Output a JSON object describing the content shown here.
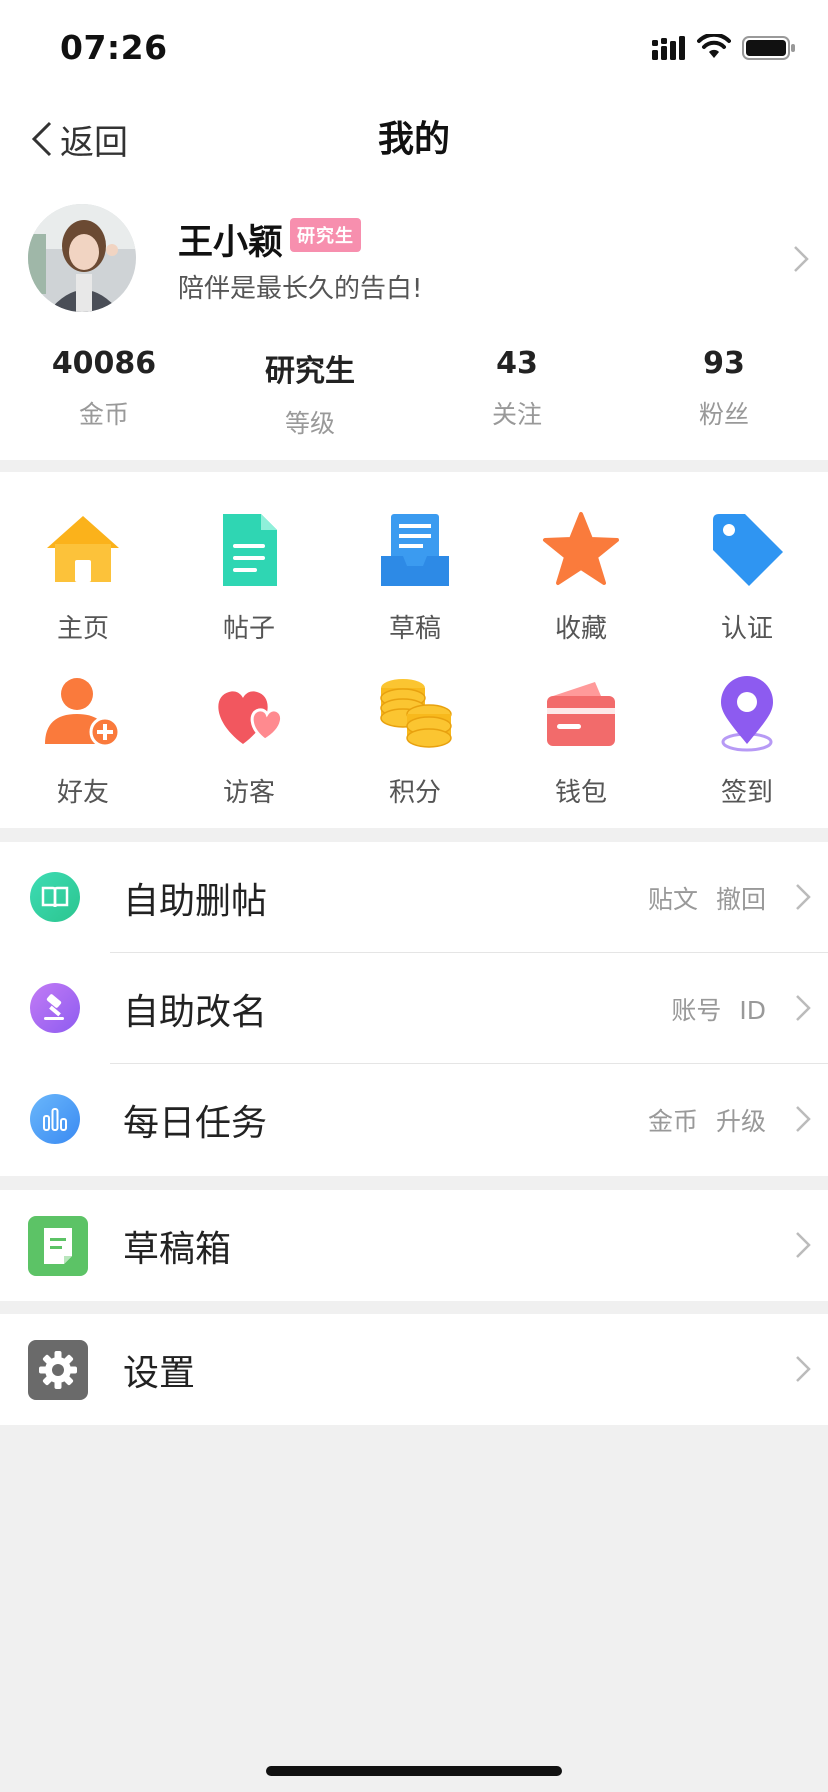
{
  "status_bar": {
    "time": "07:26"
  },
  "nav": {
    "back_label": "返回",
    "title": "我的"
  },
  "profile": {
    "name": "王小颖",
    "badge": "研究生",
    "bio": "陪伴是最长久的告白!",
    "stats": [
      {
        "value": "40086",
        "label": "金币"
      },
      {
        "value": "研究生",
        "label": "等级"
      },
      {
        "value": "43",
        "label": "关注"
      },
      {
        "value": "93",
        "label": "粉丝"
      }
    ]
  },
  "grid": {
    "items": [
      {
        "label": "主页",
        "icon": "home-icon"
      },
      {
        "label": "帖子",
        "icon": "document-icon"
      },
      {
        "label": "草稿",
        "icon": "draft-tray-icon"
      },
      {
        "label": "收藏",
        "icon": "star-icon"
      },
      {
        "label": "认证",
        "icon": "tag-icon"
      },
      {
        "label": "好友",
        "icon": "add-friend-icon"
      },
      {
        "label": "访客",
        "icon": "hearts-icon"
      },
      {
        "label": "积分",
        "icon": "coins-icon"
      },
      {
        "label": "钱包",
        "icon": "wallet-icon"
      },
      {
        "label": "签到",
        "icon": "location-pin-icon"
      }
    ]
  },
  "menu": {
    "items": [
      {
        "label": "自助删帖",
        "hint": "贴文 撤回",
        "icon": "book-icon"
      },
      {
        "label": "自助改名",
        "hint": "账号 ID",
        "icon": "gavel-icon"
      },
      {
        "label": "每日任务",
        "hint": "金币 升级",
        "icon": "bar-chart-icon"
      }
    ]
  },
  "drafts": {
    "label": "草稿箱",
    "icon": "note-icon"
  },
  "settings": {
    "label": "设置",
    "icon": "gear-icon"
  },
  "colors": {
    "badge": "#f78fae",
    "home": "#fbb21b",
    "post": "#2fd6b3",
    "draft": "#3b9bf0",
    "star": "#fa7b3c",
    "tag": "#2f95f2",
    "friend": "#fa7a3c",
    "visitor": "#f2575f",
    "coins": "#f8b91c",
    "wallet": "#f26b6b",
    "checkin": "#8d5bf0",
    "drafts_box": "#5cc366",
    "settings": "#6a6a6a"
  }
}
